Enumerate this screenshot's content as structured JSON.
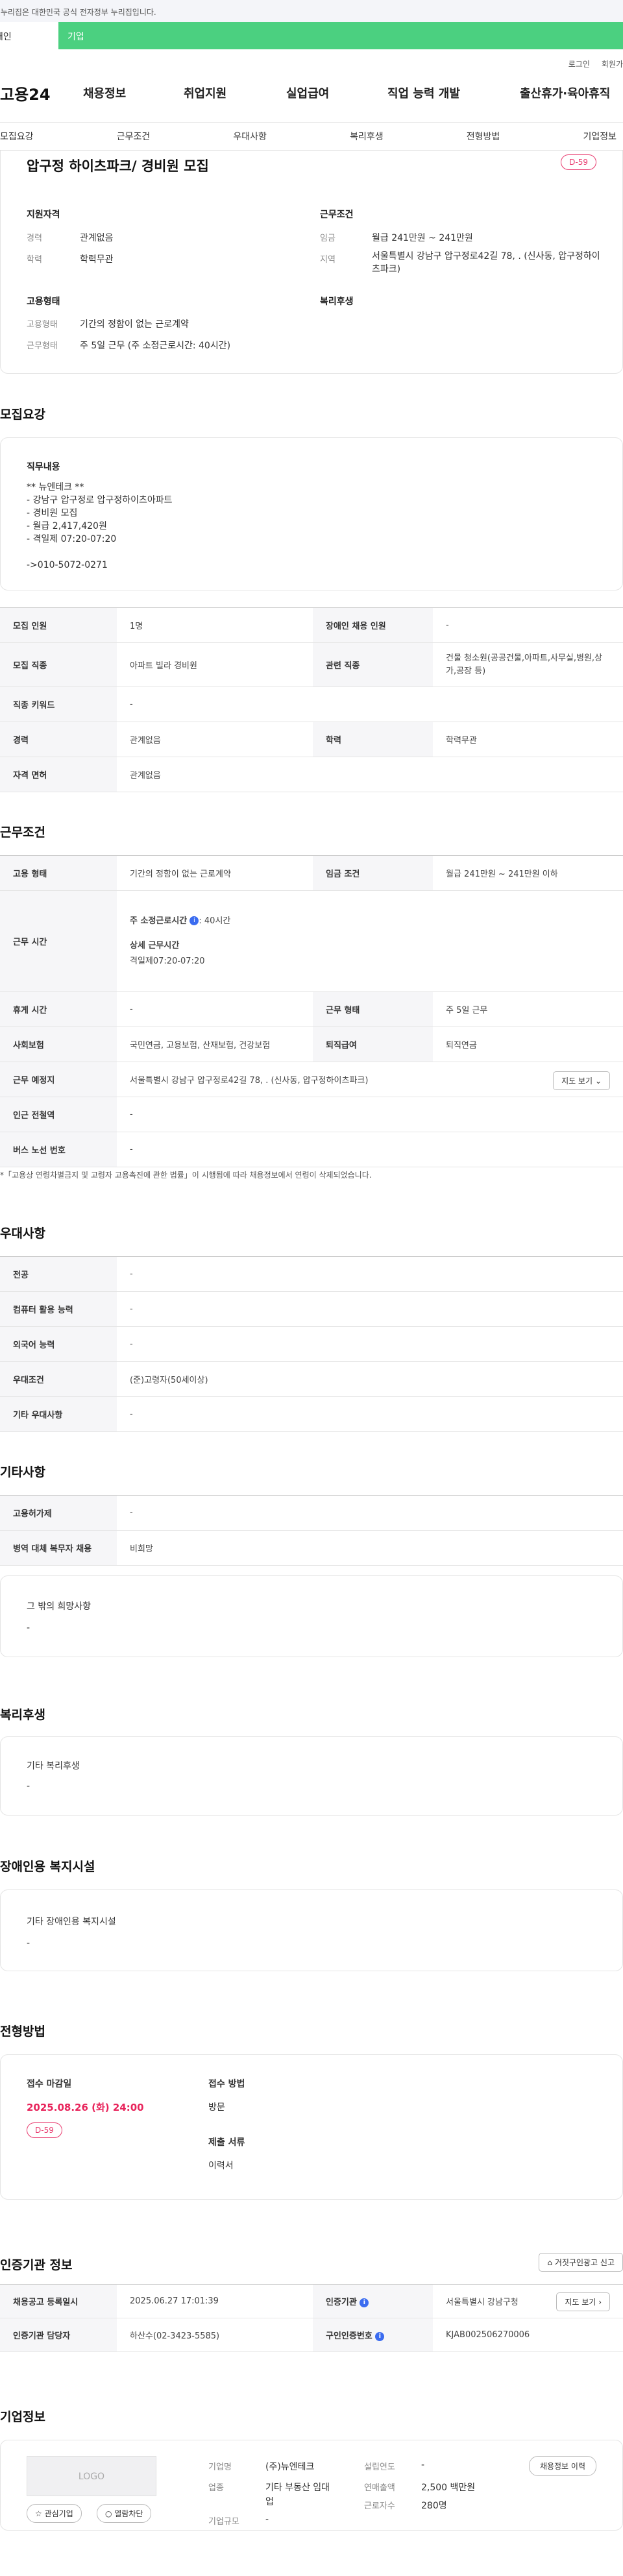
{
  "gov_banner": "이 누리집은 대한민국 공식 전자정부 누리집입니다.",
  "user_tabs": {
    "individual": "개인",
    "corporate": "기업"
  },
  "util": {
    "login": "로그인",
    "signup": "회원가"
  },
  "logo": "고용24",
  "gnb": [
    "채용정보",
    "취업지원",
    "실업급여",
    "직업 능력 개발",
    "출산휴가·육아휴직"
  ],
  "anchors": [
    "모집요강",
    "근무조건",
    "우대사항",
    "복리후생",
    "전형방법",
    "기업정보"
  ],
  "summary": {
    "title": "압구정 하이츠파크/ 경비원 모집",
    "dday": "D-59",
    "qual_title": "지원자격",
    "career_label": "경력",
    "career": "관계없음",
    "edu_label": "학력",
    "edu": "학력무관",
    "cond_title": "근무조건",
    "wage_label": "임금",
    "wage": "월급 241만원 ~ 241만원",
    "region_label": "지역",
    "region": "서울특별시 강남구 압구정로42길 78, . (신사동, 압구정하이츠파크)",
    "emp_title": "고용형태",
    "emptype_label": "고용형태",
    "emptype": "기간의 정함이 없는 근로계약",
    "worktype_label": "근무형태",
    "worktype": "주 5일 근무 (주 소정근로시간: 40시간)",
    "welfare_title": "복리후생"
  },
  "recruit": {
    "title": "모집요강",
    "duty_title": "직무내용",
    "duty_lines": [
      "** 뉴엔테크 **",
      "- 강남구 압구정로 압구정하이츠아파트",
      "- 경비원 모집",
      "- 월급 2,417,420원",
      "- 격일제 07:20-07:20",
      "",
      "->010-5072-0271"
    ],
    "rows": {
      "count_l": "모집 인원",
      "count": "1명",
      "disabled_l": "장애인 채용 인원",
      "disabled": "-",
      "job_l": "모집 직종",
      "job": "아파트 빌라 경비원",
      "related_l": "관련 직종",
      "related": "건물 청소원(공공건물,아파트,사무실,병원,상가,공장 등)",
      "kw_l": "직종 키워드",
      "kw": "-",
      "career_l": "경력",
      "career": "관계없음",
      "edu_l": "학력",
      "edu": "학력무관",
      "license_l": "자격 면허",
      "license": "관계없음"
    }
  },
  "work": {
    "title": "근무조건",
    "emp_l": "고용 형태",
    "emp": "기간의 정함이 없는 근로계약",
    "wage_l": "임금 조건",
    "wage": "월급 241만원 ~ 241만원 이하",
    "hours_l": "근무 시간",
    "weekly": "주 소정근로시간",
    "weekly_val": ": 40시간",
    "detail_l": "상세 근무시간",
    "detail": "격일제07:20-07:20",
    "rest_l": "휴게 시간",
    "rest": "-",
    "form_l": "근무 형태",
    "form": "주 5일 근무",
    "ins_l": "사회보험",
    "ins": "국민연금, 고용보험, 산재보험, 건강보험",
    "sev_l": "퇴직급여",
    "sev": "퇴직연금",
    "place_l": "근무 예정지",
    "place": "서울특별시 강남구 압구정로42길 78, . (신사동, 압구정하이츠파크)",
    "map_btn": "지도 보기",
    "sub_l": "인근 전철역",
    "sub": "-",
    "bus_l": "버스 노선 번호",
    "bus": "-",
    "notice": "*「고용상 연령차별금지 및 고령자 고용촉진에 관한 법률」이 시행됨에 따라 채용정보에서 연령이 삭제되었습니다."
  },
  "pref": {
    "title": "우대사항",
    "major_l": "전공",
    "major": "-",
    "pc_l": "컴퓨터 활용 능력",
    "pc": "-",
    "lang_l": "외국어 능력",
    "lang": "-",
    "cond_l": "우대조건",
    "cond": "(준)고령자(50세이상)",
    "etc_l": "기타 우대사항",
    "etc": "-"
  },
  "other": {
    "title": "기타사항",
    "hire_l": "고용허가제",
    "hire": "-",
    "mil_l": "병역 대체 복무자 채용",
    "mil": "비희망",
    "wish_title": "그 밖의 희망사항",
    "wish": "-"
  },
  "welfare": {
    "title": "복리후생",
    "sub": "기타 복리후생",
    "val": "-"
  },
  "disability": {
    "title": "장애인용 복지시설",
    "sub": "기타 장애인용 복지시설",
    "val": "-"
  },
  "process": {
    "title": "전형방법",
    "deadline_l": "접수 마감일",
    "deadline": "2025.08.26 (화) 24:00",
    "dday": "D-59",
    "method_l": "접수 방법",
    "method": "방문",
    "docs_l": "제출 서류",
    "docs": "이력서"
  },
  "cert": {
    "title": "인증기관 정보",
    "report_btn": "거짓구인광고 신고",
    "reg_l": "채용공고 등록일시",
    "reg": "2025.06.27 17:01:39",
    "org_l": "인증기관",
    "org": "서울특별시 강남구청",
    "view_btn": "지도 보기",
    "mgr_l": "인증기관 담당자",
    "mgr": "하산수(02-3423-5585)",
    "no_l": "구인인증번호",
    "no": "KJAB002506270006"
  },
  "company": {
    "title": "기업정보",
    "logo": "LOGO",
    "fav_btn": "관심기업",
    "block_btn": "열람차단",
    "name_l": "기업명",
    "name": "(주)뉴엔테크",
    "year_l": "설립연도",
    "year": "-",
    "ind_l": "업종",
    "ind": "기타 부동산 임대업",
    "sales_l": "연매출액",
    "sales": "2,500 백만원",
    "size_l": "기업규모",
    "size": "-",
    "emp_l": "근로자수",
    "emp": "280명",
    "hire_btn": "채용정보 이력"
  }
}
